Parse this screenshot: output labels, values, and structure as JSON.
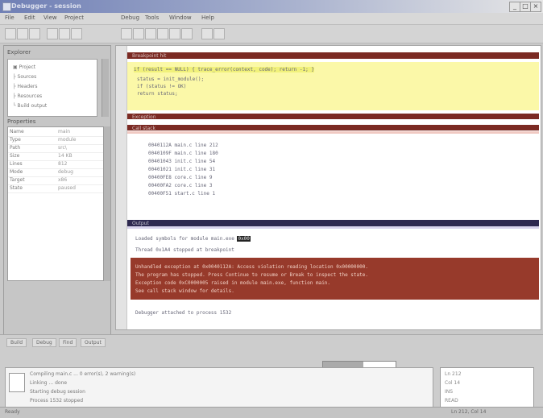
{
  "window": {
    "title": "Debugger - session",
    "min": "_",
    "max": "□",
    "close": "×"
  },
  "menu": [
    "File",
    "Edit",
    "View",
    "Project",
    "Debug",
    "Tools",
    "Window",
    "Help"
  ],
  "sidebar": {
    "header": "Explorer",
    "tree": [
      "▣ Project",
      "  ├ Sources",
      "  ├ Headers",
      "  ├ Resources",
      "  └ Build output"
    ],
    "props_header": "Properties",
    "props": [
      {
        "k": "Name",
        "v": "main"
      },
      {
        "k": "Type",
        "v": "module"
      },
      {
        "k": "Path",
        "v": "src\\"
      },
      {
        "k": "Size",
        "v": "14 KB"
      },
      {
        "k": "Lines",
        "v": "812"
      },
      {
        "k": "Mode",
        "v": "debug"
      },
      {
        "k": "Target",
        "v": "x86"
      },
      {
        "k": "State",
        "v": "paused"
      }
    ]
  },
  "editor": {
    "band1": "Breakpoint hit",
    "line_yellow": "if (result == NULL) { trace_error(context, code); return -1; }",
    "code_top": [
      "  status = init_module();",
      "  if (status != OK)",
      "    return status;"
    ],
    "band2": "Exception",
    "band3": "Call stack",
    "stack": [
      "0040112A  main.c  line 212",
      "0040109F  main.c  line 180",
      "00401043  init.c  line 54",
      "00401021  init.c  line 31",
      "00400FE8  core.c  line 9",
      "00400FA2  core.c  line 3",
      "00400F51  start.c  line 1"
    ],
    "band4": "Output",
    "out_lines": [
      "Loaded symbols for module main.exe",
      "Thread 0x1A4 stopped at breakpoint"
    ],
    "red_lines": [
      "Unhandled exception at 0x0040112A: Access violation reading location 0x00000000.",
      "The program has stopped. Press Continue to resume or Break to inspect the state.",
      "Exception code 0xC0000005 raised in module main.exe, function main.",
      "See call stack window for details."
    ],
    "last_line": "Debugger attached to process 1532",
    "token": "0x00"
  },
  "bottom": {
    "tabs": [
      "Build",
      "Debug",
      "Find",
      "Output"
    ],
    "out_lines": [
      "Compiling main.c ... 0 error(s), 2 warning(s)",
      "Linking ... done",
      "Starting debug session",
      "Process 1532 stopped"
    ],
    "progress_pct": 55,
    "right": [
      "Ln 212",
      "Col 14",
      "INS",
      "READ"
    ]
  },
  "status": {
    "left": "Ready",
    "right": "Ln 212, Col 14"
  },
  "colors": {
    "band_red": "#7b2a23",
    "band_navy": "#2e2950",
    "yellow": "#fbf8a8"
  }
}
